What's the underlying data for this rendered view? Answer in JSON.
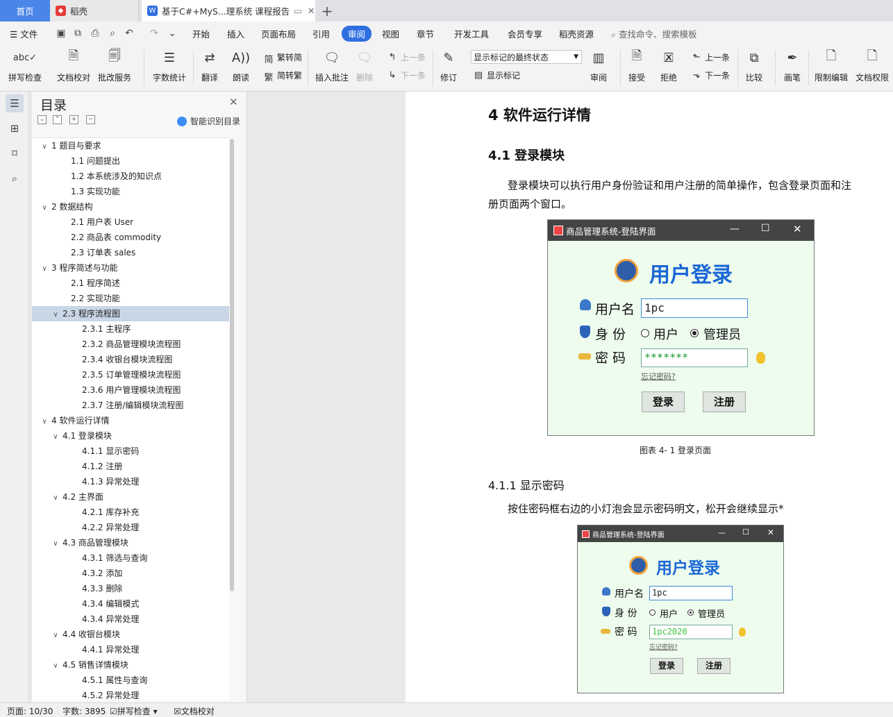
{
  "tabs": {
    "home": "首页",
    "doc1": "稻壳",
    "active": "基于C#+MyS...理系统 课程报告"
  },
  "menu": {
    "file": "文件",
    "items": [
      "开始",
      "插入",
      "页面布局",
      "引用",
      "审阅",
      "视图",
      "章节",
      "开发工具",
      "会员专享",
      "稻壳资源"
    ],
    "active_index": 4,
    "search": "查找命令、搜索模板"
  },
  "ribbon": {
    "spell": "拼写检查",
    "proof": "文档校对",
    "batch": "批改服务",
    "wordcount": "字数统计",
    "translate": "翻译",
    "read": "朗读",
    "to_trad": "繁转简",
    "to_simp": "简转繁",
    "insert_comment": "插入批注",
    "delete": "删除",
    "prev_c": "上一条",
    "next_c": "下一条",
    "revise": "修订",
    "markup_state": "显示标记的最终状态",
    "show_markup": "显示标记",
    "review": "审阅",
    "accept": "接受",
    "reject": "拒绝",
    "prev": "上一条",
    "next": "下一条",
    "compare": "比较",
    "pen": "画笔",
    "restrict": "限制编辑",
    "perm": "文档权限"
  },
  "toc": {
    "title": "目录",
    "smart": "智能识别目录",
    "items": [
      {
        "t": "1  题目与要求",
        "lv": 0,
        "ex": true
      },
      {
        "t": "1.1 问题提出",
        "lv": 1
      },
      {
        "t": "1.2 本系统涉及的知识点",
        "lv": 1
      },
      {
        "t": "1.3  实现功能",
        "lv": 1
      },
      {
        "t": "2  数据结构",
        "lv": 0,
        "ex": true
      },
      {
        "t": "2.1  用户表 User",
        "lv": 1
      },
      {
        "t": "2.2  商品表 commodity",
        "lv": 1
      },
      {
        "t": "2.3  订单表 sales",
        "lv": 1
      },
      {
        "t": "3  程序简述与功能",
        "lv": 0,
        "ex": true
      },
      {
        "t": "2.1  程序简述",
        "lv": 1
      },
      {
        "t": "2.2  实现功能",
        "lv": 1
      },
      {
        "t": "2.3  程序流程图",
        "lv": 1,
        "ex": true,
        "sel": true
      },
      {
        "t": "2.3.1  主程序",
        "lv": 2
      },
      {
        "t": "2.3.2  商品管理模块流程图",
        "lv": 2
      },
      {
        "t": "2.3.4  收银台模块流程图",
        "lv": 2
      },
      {
        "t": "2.3.5  订单管理模块流程图",
        "lv": 2
      },
      {
        "t": "2.3.6  用户管理模块流程图",
        "lv": 2
      },
      {
        "t": "2.3.7  注册/编辑模块流程图",
        "lv": 2
      },
      {
        "t": "4  软件运行详情",
        "lv": 0,
        "ex": true
      },
      {
        "t": "4.1  登录模块",
        "lv": 1,
        "ex": true
      },
      {
        "t": "4.1.1  显示密码",
        "lv": 2
      },
      {
        "t": "4.1.2  注册",
        "lv": 2
      },
      {
        "t": "4.1.3  异常处理",
        "lv": 2
      },
      {
        "t": "4.2  主界面",
        "lv": 1,
        "ex": true
      },
      {
        "t": "4.2.1  库存补充",
        "lv": 2
      },
      {
        "t": "4.2.2  异常处理",
        "lv": 2
      },
      {
        "t": "4.3  商品管理模块",
        "lv": 1,
        "ex": true
      },
      {
        "t": "4.3.1  筛选与查询",
        "lv": 2
      },
      {
        "t": "4.3.2  添加",
        "lv": 2
      },
      {
        "t": "4.3.3  删除",
        "lv": 2
      },
      {
        "t": "4.3.4  编辑模式",
        "lv": 2
      },
      {
        "t": "4.3.4  异常处理",
        "lv": 2
      },
      {
        "t": "4.4 收银台模块",
        "lv": 1,
        "ex": true
      },
      {
        "t": "4.4.1  异常处理",
        "lv": 2
      },
      {
        "t": "4.5  销售详情模块",
        "lv": 1,
        "ex": true
      },
      {
        "t": "4.5.1  属性与查询",
        "lv": 2
      },
      {
        "t": "4.5.2  异常处理",
        "lv": 2
      }
    ]
  },
  "doc": {
    "h1": "4  软件运行详情",
    "h2": "4.1  登录模块",
    "p1a": "登录模块可以执行用户身份验证和用户注册的简单操作，包含登录页面和注",
    "p1b": "册页面两个窗口。",
    "caption": "图表  4-  1 登录页面",
    "h3": "4.1.1  显示密码",
    "p2": "按住密码框右边的小灯泡会显示密码明文，松开会继续显示*",
    "login1": {
      "title": "商品管理系统-登陆界面",
      "heading": "用户登录",
      "user_lbl": "用户名",
      "user_val": "1pc",
      "role_lbl": "身  份",
      "role_user": "用户",
      "role_admin": "管理员",
      "pwd_lbl": "密  码",
      "pwd_val": "*******",
      "forgot": "忘记密码?",
      "login": "登录",
      "register": "注册"
    },
    "login2": {
      "title": "商品管理系统-登陆界面",
      "heading": "用户登录",
      "user_lbl": "用户名",
      "user_val": "1pc",
      "role_lbl": "身  份",
      "role_user": "用户",
      "role_admin": "管理员",
      "pwd_lbl": "密  码",
      "pwd_val": "1pc2020",
      "forgot": "忘记密码?",
      "login": "登录",
      "register": "注册"
    }
  },
  "status": {
    "page": "页面: 10/30",
    "words": "字数: 3895",
    "spell": "拼写检查",
    "proof": "文档校对"
  }
}
